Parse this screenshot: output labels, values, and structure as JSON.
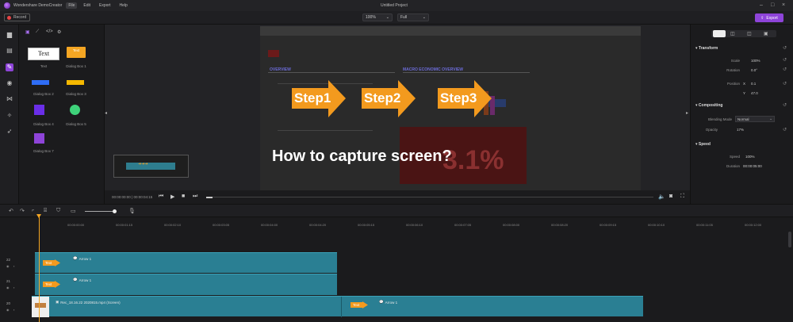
{
  "app": {
    "name": "Wondershare DemoCreator",
    "project_title": "Untitled Project"
  },
  "menu": [
    "File",
    "Edit",
    "Export",
    "Help"
  ],
  "toolbar": {
    "record_label": "Record",
    "zoom_value": "100%",
    "quality_value": "Full",
    "export_label": "Export"
  },
  "library": {
    "items": [
      {
        "label": "Text",
        "preview": "Text"
      },
      {
        "label": "Dialog Box 1",
        "preview": "Text"
      },
      {
        "label": "Dialog Box 2"
      },
      {
        "label": "Dialog Box 3"
      },
      {
        "label": "Dialog Box 4"
      },
      {
        "label": "Dialog Box 5"
      },
      {
        "label": "Dialog Box 7"
      }
    ]
  },
  "preview": {
    "steps": [
      "Step1",
      "Step2",
      "Step3"
    ],
    "caption": "How to capture screen?",
    "doc_header": "OVERVIEW",
    "doc_header2": "MACRO ECONOMIC OVERVIEW",
    "big_number": "3.1%",
    "timecode": "00:00:00:00 | 00:00:04:15"
  },
  "properties": {
    "transform_label": "Transform",
    "scale_label": "Scale",
    "scale_value": "100%",
    "rotation_label": "Rotation",
    "rotation_value": "0.0°",
    "position_label": "Position",
    "pos_x_label": "X",
    "pos_x_value": "0.1",
    "pos_y_label": "Y",
    "pos_y_value": "47.0",
    "compositing_label": "Compositing",
    "blend_label": "Blending Mode",
    "blend_value": "Normal",
    "opacity_label": "Opacity",
    "opacity_value": "17%",
    "speed_section_label": "Speed",
    "speed_label": "Speed",
    "speed_value": "100%",
    "duration_label": "Duration",
    "duration_value": "00:00:05:00"
  },
  "timeline": {
    "ticks": [
      "00:00:00:00",
      "00:00:01:15",
      "00:00:02:10",
      "00:00:03:05",
      "00:00:04:00",
      "00:00:04:20",
      "00:00:05:15",
      "00:00:06:10",
      "00:00:07:05",
      "00:00:08:00",
      "00:00:08:20",
      "00:00:09:15",
      "00:00:10:10",
      "00:00:11:05",
      "00:00:12:00"
    ],
    "tracks": [
      {
        "number": "22",
        "clip_label": "Arrow 1",
        "tag": "Text"
      },
      {
        "number": "21",
        "clip_label": "Arrow 1",
        "tag": "Text"
      },
      {
        "number": "20",
        "clip_label": "Rec_18.16.22 2020815.mp4 (Screen)",
        "clip2_label": "Arrow 1",
        "tag": "Text"
      }
    ]
  },
  "colors": {
    "accent": "#8e44d9",
    "clip": "#2a7f93",
    "arrow": "#f39a1e",
    "playhead": "#f5a623"
  }
}
